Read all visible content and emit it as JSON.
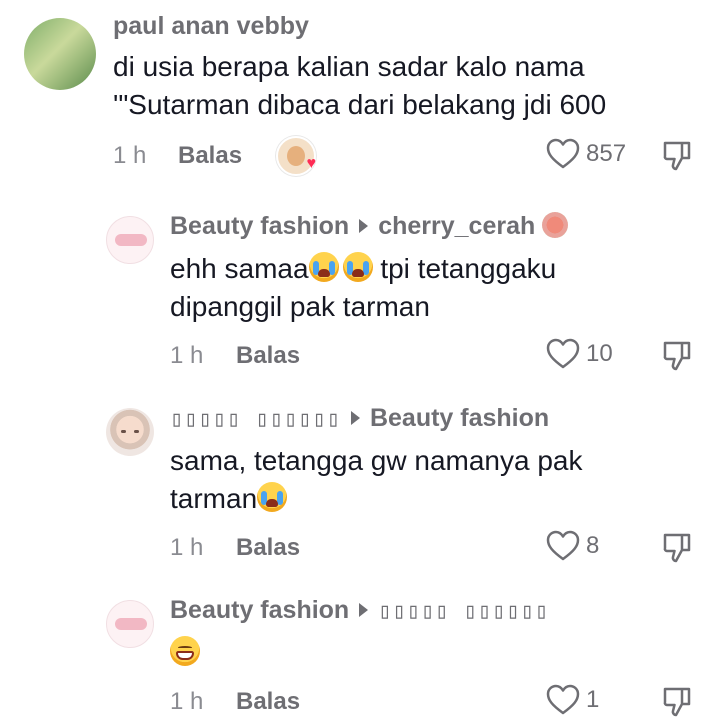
{
  "comments": [
    {
      "author": "paul anan vebby",
      "text_lines": [
        "di usia berapa kalian sadar kalo nama",
        "'\"Sutarman dibaca dari belakang jdi 600"
      ],
      "time": "1 h",
      "reply_label": "Balas",
      "likes": "857",
      "liked_by_creator": true
    },
    {
      "author": "Beauty fashion",
      "reply_to": "cherry_cerah",
      "text_parts": [
        "ehh samaa",
        " tpi tetanggaku"
      ],
      "text_line2": "dipanggil pak tarman",
      "time": "1 h",
      "reply_label": "Balas",
      "likes": "10"
    },
    {
      "author": "▯▯▯▯▯ ▯▯▯▯▯▯",
      "reply_to": "Beauty fashion",
      "text_line1": "sama, tetangga gw namanya pak",
      "text_line2": "tarman",
      "time": "1 h",
      "reply_label": "Balas",
      "likes": "8"
    },
    {
      "author": "Beauty fashion",
      "reply_to": "▯▯▯▯▯ ▯▯▯▯▯▯",
      "time": "1 h",
      "reply_label": "Balas",
      "likes": "1"
    }
  ],
  "icons": {
    "like": "heart-outline-icon",
    "dislike": "thumbs-down-icon",
    "reply_arrow": "caret-right-icon"
  },
  "colors": {
    "text": "#161823",
    "muted": "#8a8b91",
    "secondary": "#6e6e73",
    "accent": "#fe2c55"
  }
}
